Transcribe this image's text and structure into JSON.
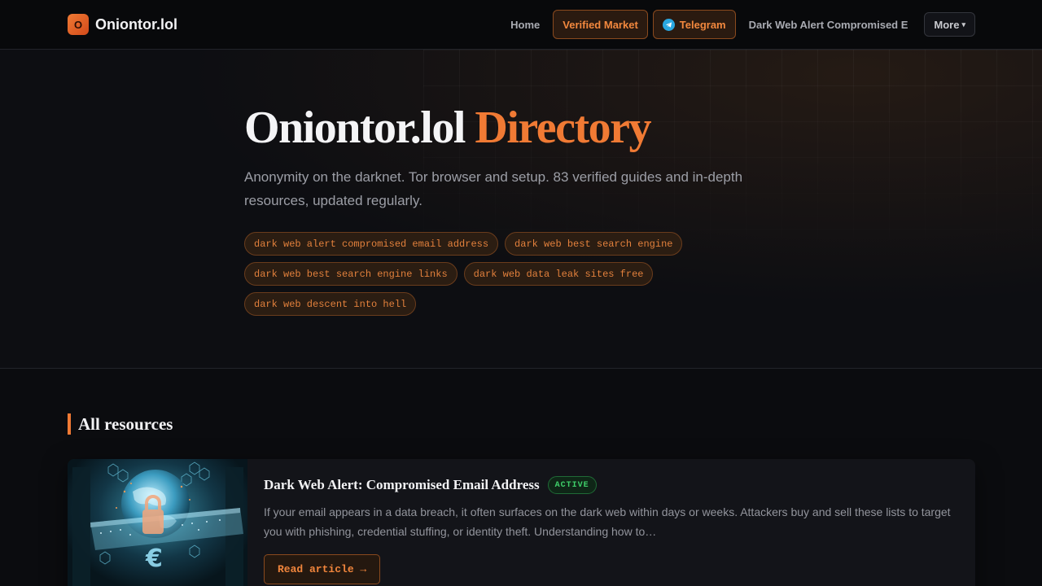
{
  "header": {
    "logo_mark": "O",
    "logo_text": "Oniontor.lol",
    "nav": {
      "home": "Home",
      "verified_market": "Verified Market",
      "telegram": "Telegram",
      "article_link": "Dark Web Alert Compromised E",
      "more": "More"
    }
  },
  "hero": {
    "title_main": "Oniontor.lol",
    "title_accent": "Directory",
    "subtitle": "Anonymity on the darknet. Tor browser and setup. 83 verified guides and in-depth resources, updated regularly.",
    "tags": [
      "dark web alert compromised email address",
      "dark web best search engine",
      "dark web best search engine links",
      "dark web data leak sites free",
      "dark web descent into hell"
    ]
  },
  "section": {
    "title": "All resources"
  },
  "cards": [
    {
      "title": "Dark Web Alert: Compromised Email Address",
      "badge": "ACTIVE",
      "excerpt": "If your email appears in a data breach, it often surfaces on the dark web within days or weeks. Attackers buy and sell these lists to target you with phishing, credential stuffing, or identity theft. Understanding how to…",
      "button": "Read article →"
    }
  ],
  "colors": {
    "accent": "#f07a34",
    "background": "#0b0c0f",
    "active_green": "#3fd06a",
    "telegram_blue": "#2aa7e0"
  },
  "icons": {
    "telegram": "telegram-icon",
    "more_caret": "chevron-down-icon"
  }
}
